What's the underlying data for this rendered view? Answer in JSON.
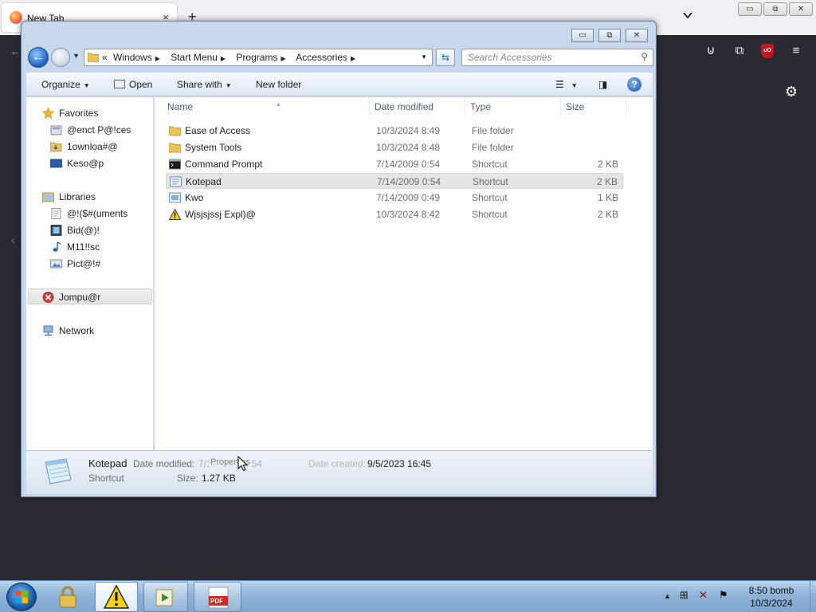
{
  "browser": {
    "tab_title": "New Tab",
    "tab_close": "×",
    "new_tab": "+",
    "ublock_label": "uO"
  },
  "explorer": {
    "caption": {
      "minimize": "▭",
      "maximize": "⧉",
      "close": "✕"
    },
    "breadcrumb": [
      "Windows",
      "Start Menu",
      "Programs",
      "Accessories"
    ],
    "breadcrumb_overflow": "«",
    "search_placeholder": "Search Accessories",
    "toolbar": {
      "organize": "Organize",
      "open": "Open",
      "share_with": "Share with",
      "new_folder": "New folder",
      "help": "?"
    },
    "nav": {
      "favorites": "Favorites",
      "fav_items": [
        "@enct P@!ces",
        "1ownloa#@",
        "Keso@p"
      ],
      "libraries": "Libraries",
      "lib_items": [
        "@!($#(uments",
        "Bid(@)!",
        "M11!!sc",
        "Pict@!#"
      ],
      "computer": "Jompu@r",
      "network": "Network"
    },
    "columns": [
      "Name",
      "Date modified",
      "Type",
      "Size"
    ],
    "files": [
      {
        "name": "Ease of Access",
        "date": "10/3/2024 8:49",
        "type": "File folder",
        "size": ""
      },
      {
        "name": "System Tools",
        "date": "10/3/2024 8:48",
        "type": "File folder",
        "size": ""
      },
      {
        "name": "Command Prompt",
        "date": "7/14/2009 0:54",
        "type": "Shortcut",
        "size": "2 KB"
      },
      {
        "name": "Kotepad",
        "date": "7/14/2009 0:54",
        "type": "Shortcut",
        "size": "2 KB"
      },
      {
        "name": "Kwo",
        "date": "7/14/2009 0:49",
        "type": "Shortcut",
        "size": "1 KB"
      },
      {
        "name": "Wjsjsjssj Expl)@",
        "date": "10/3/2024 8:42",
        "type": "Shortcut",
        "size": "2 KB"
      }
    ],
    "details": {
      "name": "Kotepad",
      "kind": "Shortcut",
      "date_modified_label": "Date modified:",
      "date_modified_value": "7/14/2009 0:54",
      "date_created_label": "Date created:",
      "date_created_value": "9/5/2023 16:45",
      "size_label": "Size:",
      "size_value": "1.27 KB"
    },
    "tooltip": "Properties"
  },
  "taskbar": {
    "pdf_label": "PDF",
    "clock_time": "8:50 bomb",
    "clock_date": "10/3/2024"
  },
  "colors": {
    "selection": "#e5e5e5",
    "firefox_dark": "#2b2a33",
    "folder": "#e8c25a",
    "taskbar": "#8fb3d7"
  }
}
